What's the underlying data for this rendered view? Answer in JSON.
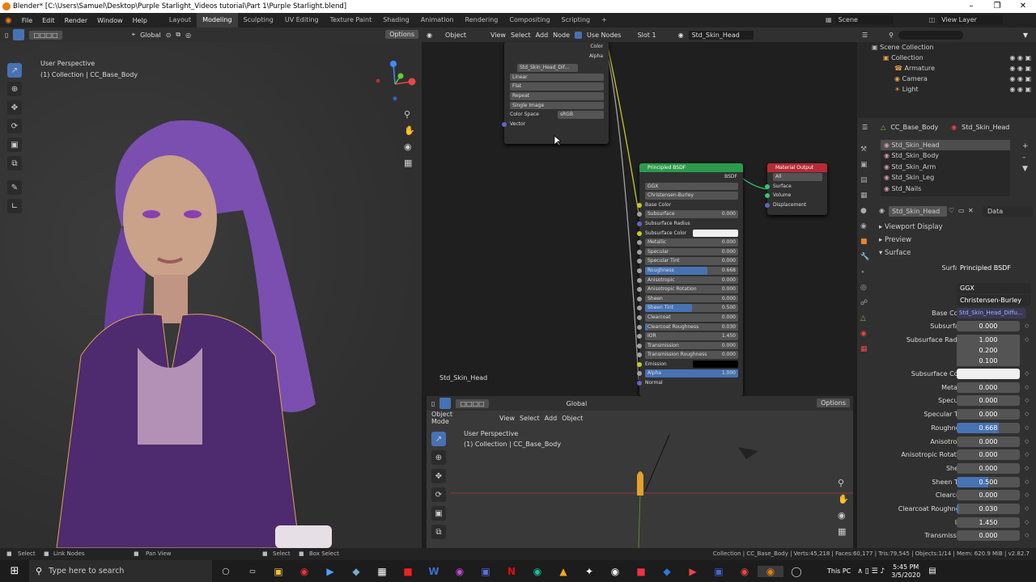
{
  "window": {
    "title": "Blender* [C:\\Users\\Samuel\\Desktop\\Purple Starlight_Videos tutorial\\Part 1\\Purple Starlight.blend]"
  },
  "menu": {
    "file": "File",
    "edit": "Edit",
    "render": "Render",
    "window": "Window",
    "help": "Help"
  },
  "workspaces": [
    "Layout",
    "Modeling",
    "Sculpting",
    "UV Editing",
    "Texture Paint",
    "Shading",
    "Animation",
    "Rendering",
    "Compositing",
    "Scripting"
  ],
  "scene": "Scene",
  "view_layer": "View Layer",
  "viewport": {
    "mode": "Object Mode",
    "view": "View",
    "select": "Select",
    "add": "Add",
    "object": "Object",
    "transform": "Global",
    "options": "Options",
    "perspective": "User Perspective",
    "collection": "(1) Collection | CC_Base_Body"
  },
  "node_editor": {
    "editor": "Object",
    "view": "View",
    "select": "Select",
    "add": "Add",
    "node": "Node",
    "use_nodes": "Use Nodes",
    "slot": "Slot 1",
    "material": "Std_Skin_Head",
    "footer_label": "Std_Skin_Head",
    "image_node": {
      "title": "Std_Skin_Head_Dif...",
      "out_color": "Color",
      "out_alpha": "Alpha",
      "interpolation": "Linear",
      "projection": "Flat",
      "extension": "Repeat",
      "source": "Single Image",
      "colorspace_label": "Color Space",
      "colorspace": "sRGB",
      "vector": "Vector"
    },
    "bsdf_node": {
      "title": "Principled BSDF",
      "out": "BSDF",
      "distribution": "GGX",
      "sss_method": "Christensen-Burley",
      "inputs": [
        {
          "name": "Base Color",
          "value": "",
          "color": "#c7c729"
        },
        {
          "name": "Subsurface",
          "value": "0.000",
          "color": "#a1a1a1"
        },
        {
          "name": "Subsurface Radius",
          "value": "",
          "color": "#6363c7"
        },
        {
          "name": "Subsurface Color",
          "value": "",
          "color": "#c7c729"
        },
        {
          "name": "Metallic",
          "value": "0.000",
          "color": "#a1a1a1"
        },
        {
          "name": "Specular",
          "value": "0.000",
          "color": "#a1a1a1"
        },
        {
          "name": "Specular Tint",
          "value": "0.000",
          "color": "#a1a1a1"
        },
        {
          "name": "Roughness",
          "value": "0.668",
          "color": "#a1a1a1"
        },
        {
          "name": "Anisotropic",
          "value": "0.000",
          "color": "#a1a1a1"
        },
        {
          "name": "Anisotropic Rotation",
          "value": "0.000",
          "color": "#a1a1a1"
        },
        {
          "name": "Sheen",
          "value": "0.000",
          "color": "#a1a1a1"
        },
        {
          "name": "Sheen Tint",
          "value": "0.500",
          "color": "#a1a1a1"
        },
        {
          "name": "Clearcoat",
          "value": "0.000",
          "color": "#a1a1a1"
        },
        {
          "name": "Clearcoat Roughness",
          "value": "0.030",
          "color": "#a1a1a1"
        },
        {
          "name": "IOR",
          "value": "1.450",
          "color": "#a1a1a1"
        },
        {
          "name": "Transmission",
          "value": "0.000",
          "color": "#a1a1a1"
        },
        {
          "name": "Transmission Roughness",
          "value": "0.000",
          "color": "#a1a1a1"
        },
        {
          "name": "Emission",
          "value": "",
          "color": "#c7c729"
        },
        {
          "name": "Alpha",
          "value": "1.000",
          "color": "#a1a1a1"
        },
        {
          "name": "Normal",
          "value": "",
          "color": "#6363c7"
        }
      ]
    },
    "output_node": {
      "title": "Material Output",
      "target": "All",
      "surface": "Surface",
      "volume": "Volume",
      "displacement": "Displacement"
    }
  },
  "outliner": {
    "root": "Scene Collection",
    "items": [
      {
        "name": "Collection",
        "depth": 1
      },
      {
        "name": "Armature",
        "depth": 2
      },
      {
        "name": "Camera",
        "depth": 2
      },
      {
        "name": "Light",
        "depth": 2
      }
    ]
  },
  "properties": {
    "object": "CC_Base_Body",
    "material": "Std_Skin_Head",
    "slots": [
      "Std_Skin_Head",
      "Std_Skin_Body",
      "Std_Skin_Arm",
      "Std_Skin_Leg",
      "Std_Nails"
    ],
    "data_label": "Data",
    "panels": {
      "viewport_display": "Viewport Display",
      "preview": "Preview",
      "surface": "Surface"
    },
    "surface_label": "Surface",
    "surface_shader": "Principled BSDF",
    "distribution": "GGX",
    "sss_method": "Christensen-Burley",
    "base_color_label": "Base Color",
    "base_color_tex": "Std_Skin_Head_Diffu...",
    "subsurface_radius": [
      "1.000",
      "0.200",
      "0.100"
    ],
    "rows": [
      {
        "label": "Subsurface",
        "value": "0.000"
      },
      {
        "label": "Subsurface Radius",
        "value": ""
      },
      {
        "label": "Subsurface Color",
        "value": ""
      },
      {
        "label": "Metallic",
        "value": "0.000"
      },
      {
        "label": "Specular",
        "value": "0.000"
      },
      {
        "label": "Specular Tint",
        "value": "0.000"
      },
      {
        "label": "Roughness",
        "value": "0.668"
      },
      {
        "label": "Anisotropic",
        "value": "0.000"
      },
      {
        "label": "Anisotropic Rotation",
        "value": "0.000"
      },
      {
        "label": "Sheen",
        "value": "0.000"
      },
      {
        "label": "Sheen Tint",
        "value": "0.500"
      },
      {
        "label": "Clearcoat",
        "value": "0.000"
      },
      {
        "label": "Clearcoat Roughness",
        "value": "0.030"
      },
      {
        "label": "IOR",
        "value": "1.450"
      },
      {
        "label": "Transmission",
        "value": "0.000"
      }
    ]
  },
  "statusbar": {
    "select": "Select",
    "link_nodes": "Link Nodes",
    "pan_view": "Pan View",
    "select2": "Select",
    "box_select": "Box Select",
    "stats": "Collection | CC_Base_Body | Verts:45,218 | Faces:60,177 | Tris:79,545 | Objects:1/14 | Mem: 620.9 MiB | v2.82.7"
  },
  "taskbar": {
    "search_placeholder": "Type here to search",
    "this_pc": "This PC",
    "time": "5:45 PM",
    "date": "3/5/2020"
  },
  "colors": {
    "accent": "#4772b3",
    "shader_header": "#2b9a4c",
    "output_header": "#b62b35",
    "bg": "#1d1d1d"
  }
}
